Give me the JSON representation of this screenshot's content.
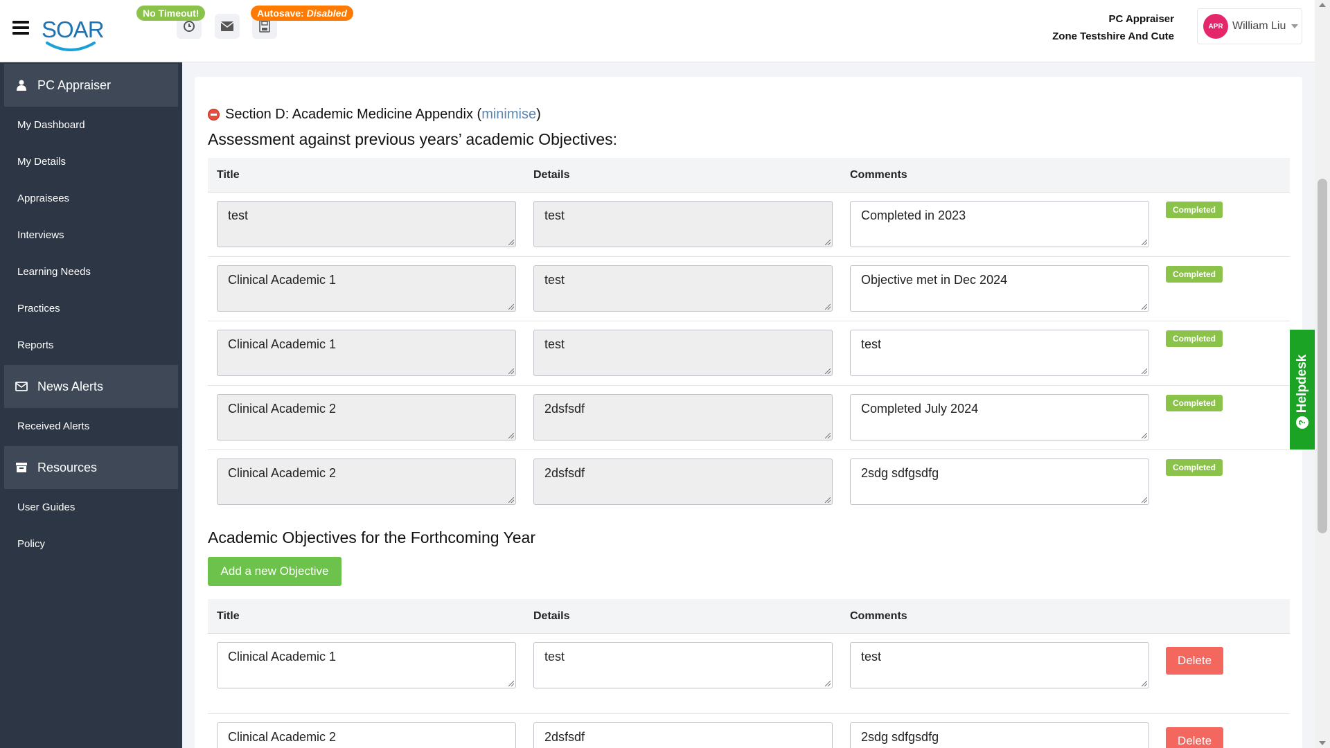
{
  "header": {
    "logo_text": "SOAR",
    "no_timeout_label": "No Timeout!",
    "autosave_prefix": "Autosave:",
    "autosave_state": "Disabled",
    "role": "PC Appraiser",
    "zone": "Zone Testshire And Cute",
    "avatar_text": "APR",
    "user_name": "William Liu",
    "icons": [
      "menu-icon",
      "clock-icon",
      "mail-icon",
      "save-icon",
      "chevron-down-icon"
    ]
  },
  "sidebar": {
    "sections": [
      {
        "title": "PC Appraiser",
        "icon": "user-icon",
        "items": [
          "My Dashboard",
          "My Details",
          "Appraisees",
          "Interviews",
          "Learning Needs",
          "Practices",
          "Reports"
        ]
      },
      {
        "title": "News Alerts",
        "icon": "envelope-icon",
        "items": [
          "Received Alerts"
        ]
      },
      {
        "title": "Resources",
        "icon": "archive-icon",
        "items": [
          "User Guides",
          "Policy"
        ]
      }
    ]
  },
  "main": {
    "section_prefix": "Section D: Academic Medicine Appendix (",
    "minimise_link": "minimise",
    "section_suffix": ")",
    "previous_heading": "Assessment against previous years’ academic Objectives:",
    "columns": {
      "title": "Title",
      "details": "Details",
      "comments": "Comments"
    },
    "previous_rows": [
      {
        "title": "test",
        "details": "test",
        "comments": "Completed in 2023",
        "status": "Completed"
      },
      {
        "title": "Clinical Academic 1",
        "details": "test",
        "comments": "Objective met in Dec 2024",
        "status": "Completed"
      },
      {
        "title": "Clinical Academic 1",
        "details": "test",
        "comments": "test",
        "status": "Completed"
      },
      {
        "title": "Clinical Academic 2",
        "details": "2dsfsdf",
        "comments": "Completed July 2024",
        "status": "Completed"
      },
      {
        "title": "Clinical Academic 2",
        "details": "2dsfsdf",
        "comments": "2sdg sdfgsdfg",
        "status": "Completed"
      }
    ],
    "forthcoming_heading": "Academic Objectives for the Forthcoming Year",
    "add_button_label": "Add a new Objective",
    "forthcoming_rows": [
      {
        "title": "Clinical Academic 1",
        "details": "test",
        "comments": "test",
        "action": "Delete"
      },
      {
        "title": "Clinical Academic 2",
        "details": "2dsfsdf",
        "comments": "2sdg sdfgsdfg",
        "action": "Delete"
      }
    ]
  },
  "helpdesk": {
    "label": "Helpdesk",
    "icon": "question-circle-icon"
  },
  "colors": {
    "sidebar_bg": "#2d3644",
    "sidebar_section_bg": "#3e4857",
    "completed_badge": "#8bc34a",
    "add_button": "#6cc24a",
    "delete_button": "#f3675e",
    "helpdesk": "#1aa324",
    "autosave_pill": "#ff7a00"
  }
}
